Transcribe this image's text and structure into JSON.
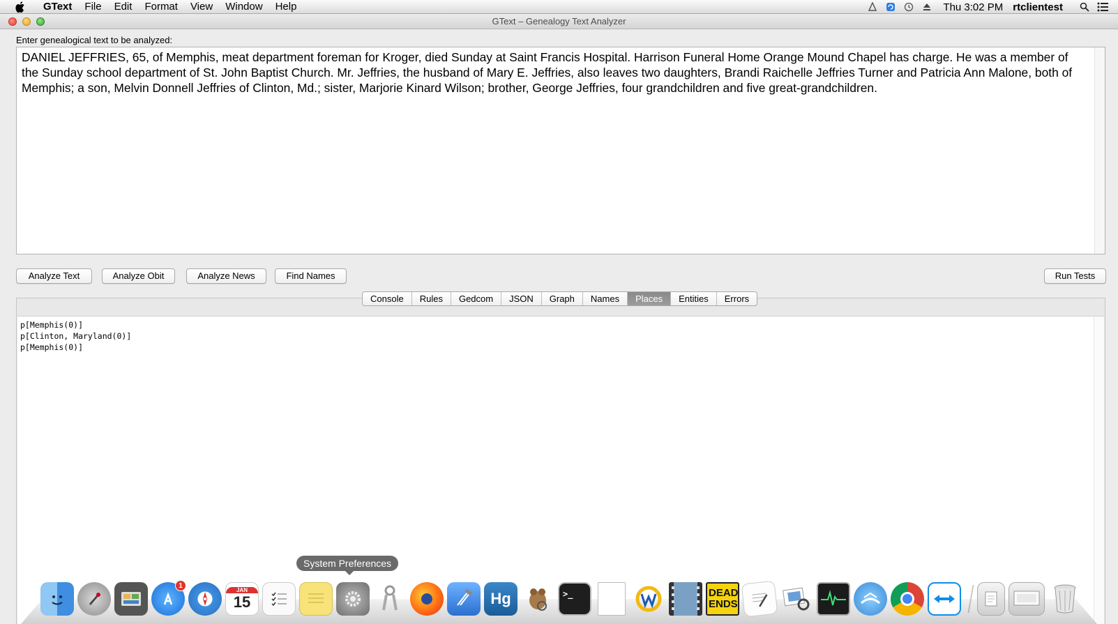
{
  "menubar": {
    "app_name": "GText",
    "items": [
      "File",
      "Edit",
      "Format",
      "View",
      "Window",
      "Help"
    ],
    "clock": "Thu 3:02 PM",
    "user": "rtclientest"
  },
  "window": {
    "title": "GText – Genealogy Text Analyzer"
  },
  "input": {
    "label": "Enter genealogical text to be analyzed:",
    "text": "DANIEL JEFFRIES, 65, of Memphis, meat department foreman for Kroger, died Sunday at Saint Francis Hospital. Harrison Funeral Home Orange Mound Chapel has charge. He was a member of the Sunday school department of St. John Baptist Church. Mr. Jeffries, the husband of Mary E. Jeffries, also leaves two daughters, Brandi Raichelle Jeffries Turner and Patricia Ann Malone, both of Memphis; a son, Melvin Donnell Jeffries of Clinton, Md.; sister, Marjorie Kinard Wilson; brother, George Jeffries, four grandchildren and five great-grandchildren."
  },
  "buttons": {
    "analyze_text": "Analyze Text",
    "analyze_obit": "Analyze Obit",
    "analyze_news": "Analyze News",
    "find_names": "Find Names",
    "run_tests": "Run Tests"
  },
  "tabs": [
    {
      "label": "Console"
    },
    {
      "label": "Rules"
    },
    {
      "label": "Gedcom"
    },
    {
      "label": "JSON"
    },
    {
      "label": "Graph"
    },
    {
      "label": "Names"
    },
    {
      "label": "Places",
      "active": true
    },
    {
      "label": "Entities"
    },
    {
      "label": "Errors"
    }
  ],
  "output": {
    "lines": [
      "p[Memphis(0)]",
      "p[Clinton, Maryland(0)]",
      "p[Memphis(0)]"
    ]
  },
  "dock": {
    "tooltip": "System Preferences",
    "app_store_badge": "1",
    "calendar_day": "15",
    "calendar_month": "JAN",
    "hg_label": "Hg",
    "dead_ends_label": "DEAD ENDS"
  }
}
